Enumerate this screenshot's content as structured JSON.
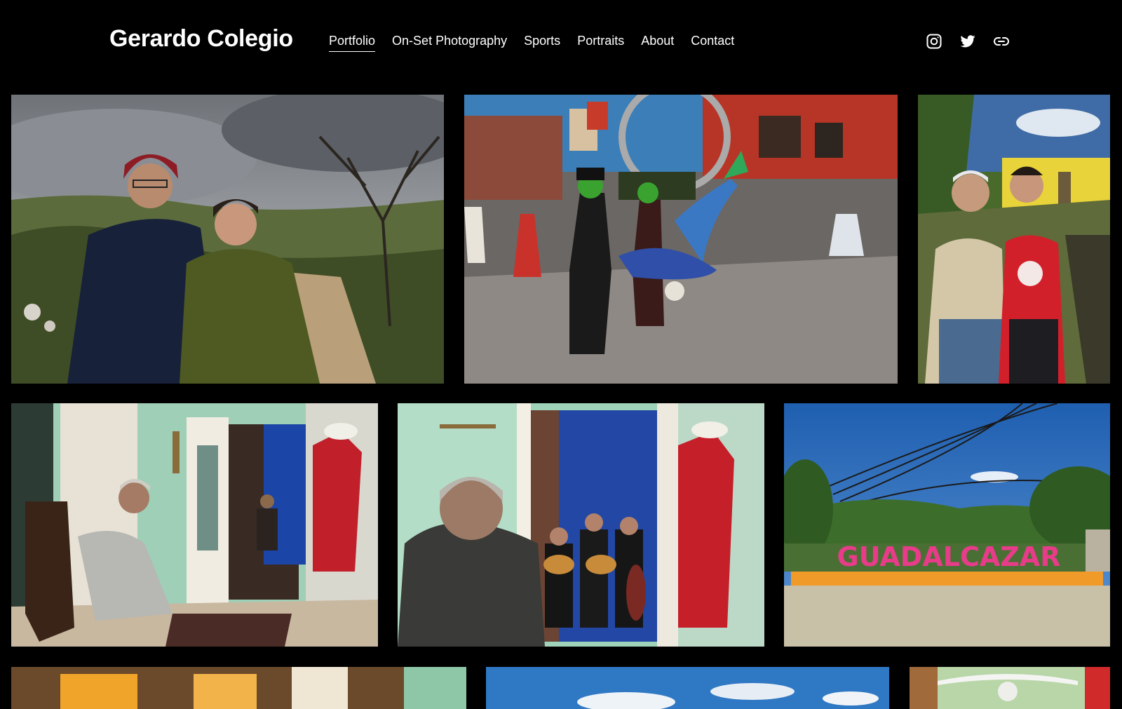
{
  "site": {
    "title": "Gerardo Colegio"
  },
  "nav": {
    "items": [
      {
        "label": "Portfolio",
        "active": true
      },
      {
        "label": "On-Set Photography",
        "active": false
      },
      {
        "label": "Sports",
        "active": false
      },
      {
        "label": "Portraits",
        "active": false
      },
      {
        "label": "About",
        "active": false
      },
      {
        "label": "Contact",
        "active": false
      }
    ]
  },
  "social": {
    "icons": [
      "instagram-icon",
      "twitter-icon",
      "link-icon"
    ]
  },
  "gallery": {
    "photos": [
      {
        "subject": "couple-in-countryside"
      },
      {
        "subject": "hard-rock-cafe-street-performers"
      },
      {
        "subject": "father-and-son-portrait"
      },
      {
        "subject": "woman-seated-by-door-with-mariachis"
      },
      {
        "subject": "man-watching-mariachis-in-doorway"
      },
      {
        "subject": "guadalcazar-colorful-sign"
      },
      {
        "subject": "interior-warm-light-partial"
      },
      {
        "subject": "sky-and-clouds-partial"
      },
      {
        "subject": "ceiling-fan-partial"
      }
    ],
    "sign_text": "GUADALCAZAR"
  },
  "colors": {
    "background": "#000000",
    "text": "#ffffff"
  }
}
